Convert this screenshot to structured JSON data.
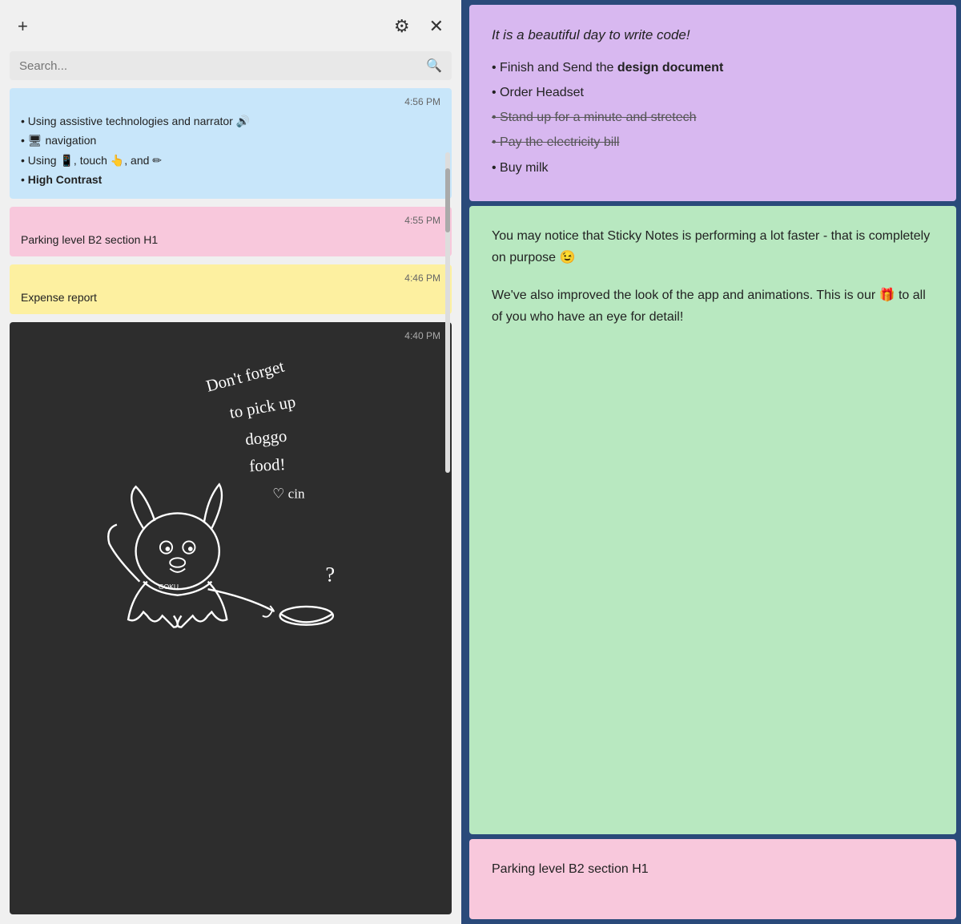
{
  "toolbar": {
    "add_label": "+",
    "settings_label": "⚙",
    "close_label": "✕"
  },
  "search": {
    "placeholder": "Search...",
    "icon": "🔍"
  },
  "notes": [
    {
      "id": "note-blue",
      "color": "blue",
      "time": "4:56 PM",
      "lines": [
        "• Using assistive technologies and narrator 🔊",
        "• 🖥 navigation",
        "• Using 📱, touch 👆, and ✏",
        "• High Contrast"
      ],
      "last_bold": true
    },
    {
      "id": "note-pink",
      "color": "pink",
      "time": "4:55 PM",
      "text": "Parking level B2 section H1"
    },
    {
      "id": "note-yellow",
      "color": "yellow",
      "time": "4:46 PM",
      "text": "Expense report"
    },
    {
      "id": "note-dark",
      "color": "dark",
      "time": "4:40 PM",
      "has_drawing": true
    }
  ],
  "right_notes": [
    {
      "id": "right-purple",
      "color": "purple",
      "header": "It is a beautiful day to write code!",
      "items": [
        {
          "text": "Finish and Send the design document",
          "bold_part": "design document",
          "strikethrough": false
        },
        {
          "text": "Order Headset",
          "strikethrough": false
        },
        {
          "text": "Stand up for a minute and stretech",
          "strikethrough": true
        },
        {
          "text": "Pay the electricity bill",
          "strikethrough": true
        },
        {
          "text": "Buy milk",
          "strikethrough": false
        }
      ]
    },
    {
      "id": "right-green",
      "color": "green",
      "paragraphs": [
        "You may notice that Sticky Notes is performing a lot faster - that is completely on purpose 😉",
        "We've also improved the look of the app and animations. This is our 🎁 to all of you who have an eye for detail!"
      ]
    },
    {
      "id": "right-pink",
      "color": "light-pink",
      "text": "Parking level B2 section H1"
    }
  ]
}
